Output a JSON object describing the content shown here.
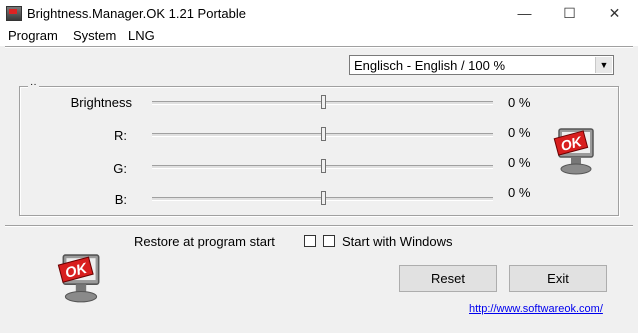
{
  "window": {
    "title": "Brightness.Manager.OK 1.21 Portable",
    "minimize_glyph": "—",
    "maximize_glyph": "☐",
    "close_glyph": "✕"
  },
  "menu": {
    "items": [
      "Program",
      "System",
      "LNG"
    ]
  },
  "language_select": {
    "value": "Englisch - English / 100 %",
    "arrow": "▼"
  },
  "group": {
    "marker": "··"
  },
  "sliders": [
    {
      "label": "Brightness",
      "value_text": "0 %",
      "level": 0.5
    },
    {
      "label": "R:",
      "value_text": "0 %",
      "level": 0.5
    },
    {
      "label": "G:",
      "value_text": "0 %",
      "level": 0.5
    },
    {
      "label": "B:",
      "value_text": "0 %",
      "level": 0.5
    }
  ],
  "options": {
    "restore_label": "Restore at program start",
    "restore_checked": false,
    "start_windows_label": "Start with Windows",
    "start_windows_checked": false
  },
  "buttons": {
    "reset": "Reset",
    "exit": "Exit"
  },
  "link": "http://www.softwareok.com/",
  "logo_text": "OK",
  "colors": {
    "accent_red": "#d81e1e",
    "link_blue": "#0000ee",
    "window_bg": "#f0f0f0"
  }
}
